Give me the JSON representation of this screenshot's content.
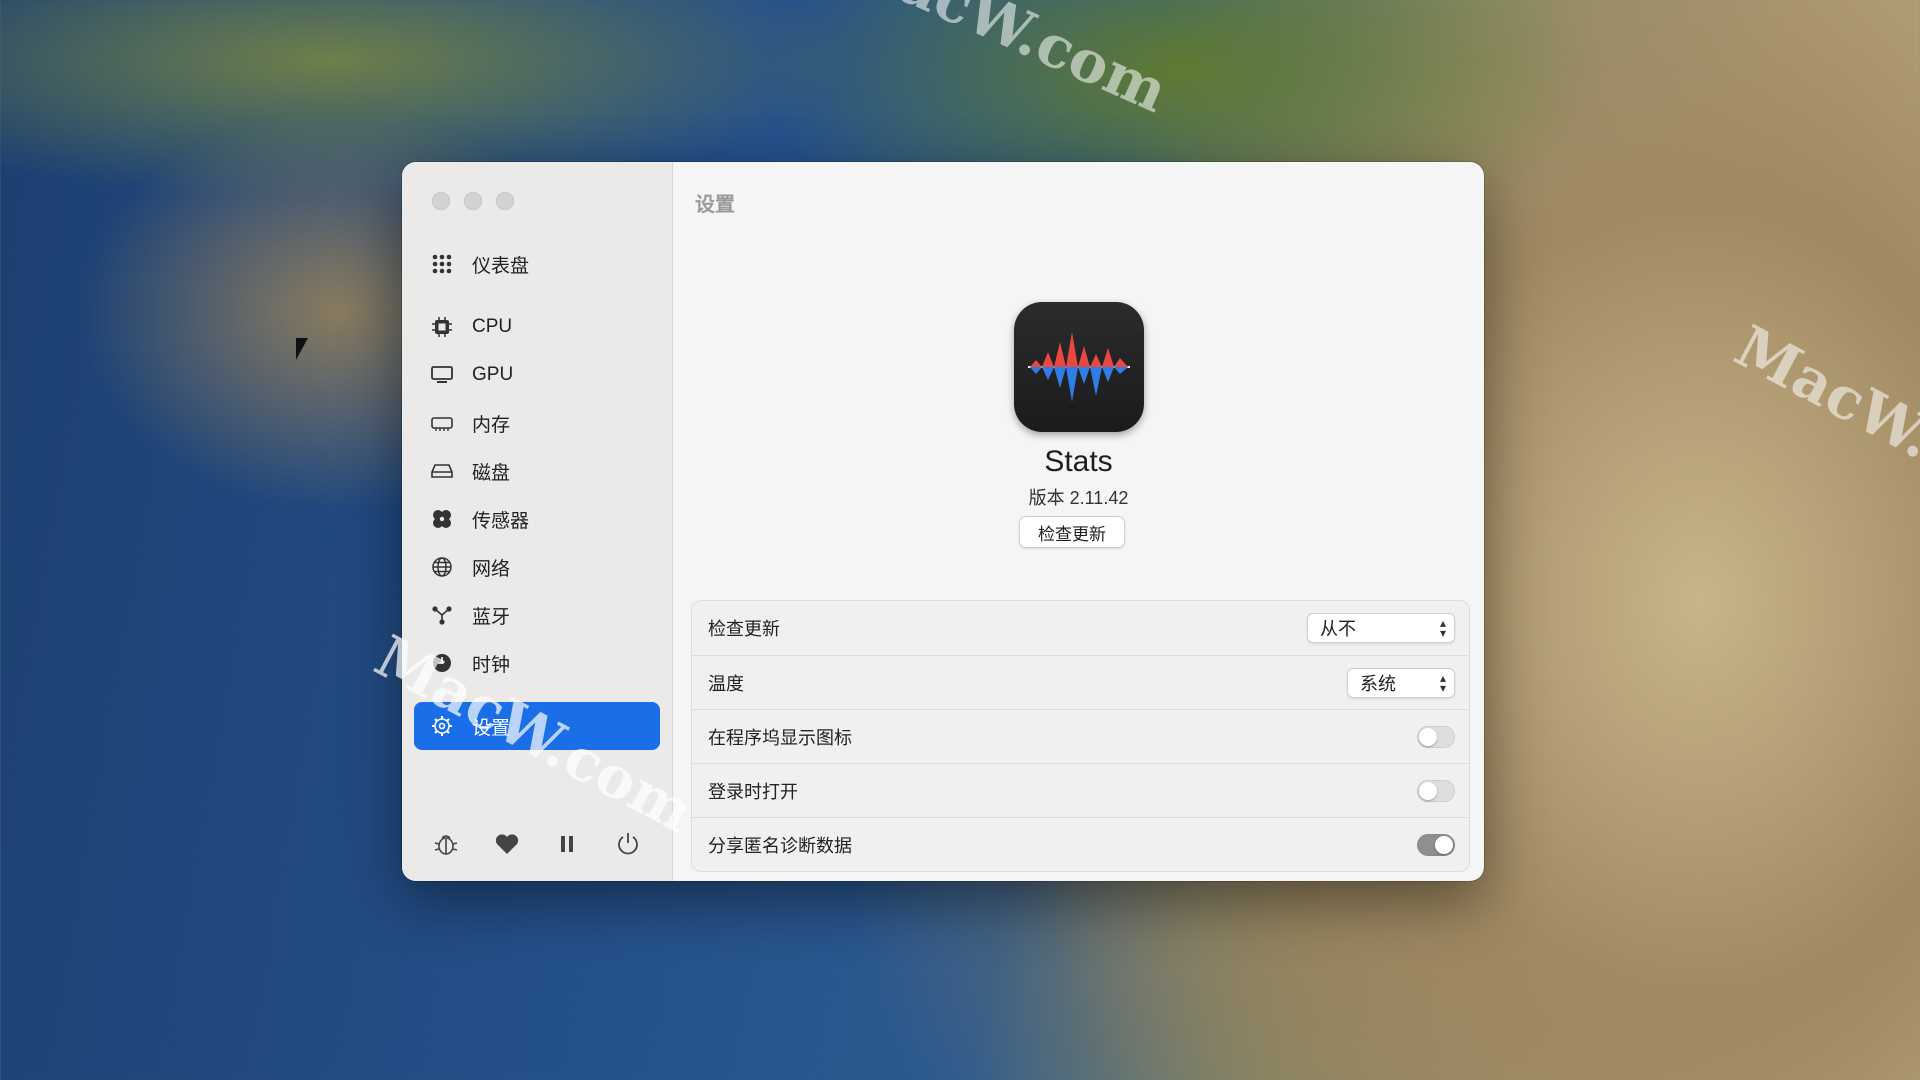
{
  "watermark": "MacW.com",
  "window": {
    "title": "设置",
    "sidebar": {
      "items": [
        {
          "label": "仪表盘",
          "icon": "grid-icon"
        },
        {
          "label": "CPU",
          "icon": "cpu-icon"
        },
        {
          "label": "GPU",
          "icon": "display-icon"
        },
        {
          "label": "内存",
          "icon": "memory-icon"
        },
        {
          "label": "磁盘",
          "icon": "disk-icon"
        },
        {
          "label": "传感器",
          "icon": "fan-icon"
        },
        {
          "label": "网络",
          "icon": "globe-icon"
        },
        {
          "label": "蓝牙",
          "icon": "bluetooth-icon"
        },
        {
          "label": "时钟",
          "icon": "clock-icon"
        },
        {
          "label": "设置",
          "icon": "settings-icon",
          "active": true
        }
      ],
      "bottom": [
        "bug-icon",
        "heart-icon",
        "pause-icon",
        "power-icon"
      ]
    },
    "about": {
      "app_name": "Stats",
      "version": "版本 2.11.42",
      "check_button": "检查更新"
    },
    "settings": {
      "rows": [
        {
          "label": "检查更新",
          "control": "select",
          "value": "从不"
        },
        {
          "label": "温度",
          "control": "select",
          "value": "系统"
        },
        {
          "label": "在程序坞显示图标",
          "control": "toggle",
          "on": false
        },
        {
          "label": "登录时打开",
          "control": "toggle",
          "on": false
        },
        {
          "label": "分享匿名诊断数据",
          "control": "toggle",
          "on": true
        }
      ]
    }
  },
  "colors": {
    "accent": "#1a6ee8",
    "chart_red": "#e8483f",
    "chart_blue": "#2f7de8"
  }
}
